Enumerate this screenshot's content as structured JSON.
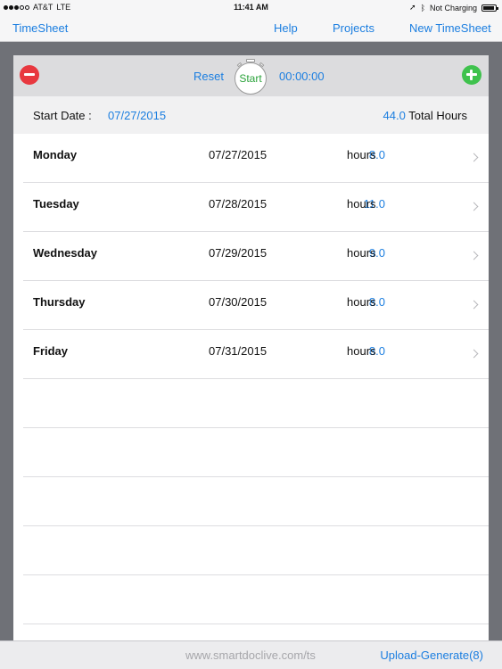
{
  "status_bar": {
    "carrier": "AT&T",
    "network": "LTE",
    "time": "11:41 AM",
    "charging": "Not Charging",
    "battery_level": 0.95,
    "signal_bars_filled": 3,
    "signal_bars_total": 5
  },
  "nav": {
    "title": "TimeSheet",
    "help": "Help",
    "projects": "Projects",
    "new_timesheet": "New TimeSheet"
  },
  "toolbar": {
    "reset": "Reset",
    "start": "Start",
    "timer": "00:00:00"
  },
  "summary": {
    "start_date_label": "Start Date :",
    "start_date": "07/27/2015",
    "total_hours": "44.0",
    "total_label": "Total Hours"
  },
  "entries": [
    {
      "day": "Monday",
      "date": "07/27/2015",
      "hours": "8.0",
      "unit": "hours"
    },
    {
      "day": "Tuesday",
      "date": "07/28/2015",
      "hours": "11.0",
      "unit": "hours"
    },
    {
      "day": "Wednesday",
      "date": "07/29/2015",
      "hours": "9.0",
      "unit": "hours"
    },
    {
      "day": "Thursday",
      "date": "07/30/2015",
      "hours": "8.0",
      "unit": "hours"
    },
    {
      "day": "Friday",
      "date": "07/31/2015",
      "hours": "8.0",
      "unit": "hours"
    }
  ],
  "footer": {
    "url": "www.smartdoclive.com/ts",
    "upload": "Upload-Generate(8)"
  },
  "colors": {
    "accent": "#1b7ee0",
    "start_green": "#2aa23a",
    "minus_red": "#e8383f",
    "plus_green": "#3fc24d"
  }
}
